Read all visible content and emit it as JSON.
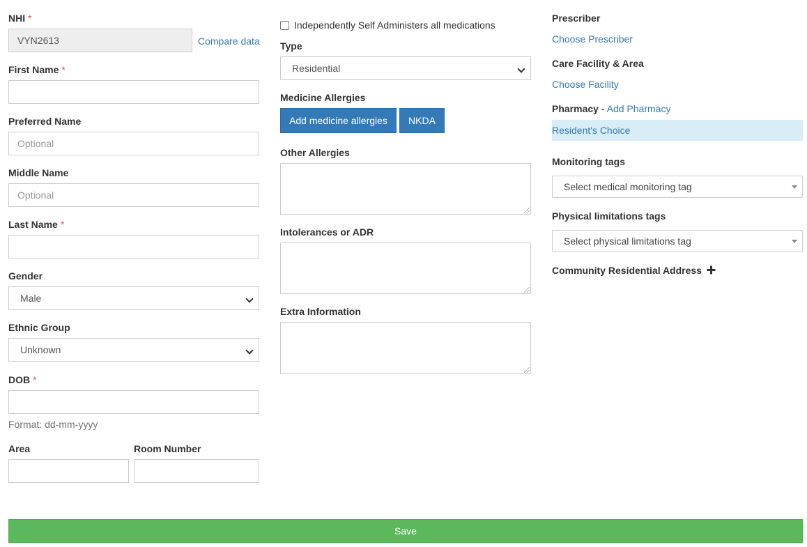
{
  "left": {
    "nhi": {
      "label": "NHI",
      "required": "*",
      "value": "VYN2613",
      "compare_link": "Compare data"
    },
    "first_name": {
      "label": "First Name",
      "required": "*",
      "value": ""
    },
    "preferred_name": {
      "label": "Preferred Name",
      "placeholder": "Optional"
    },
    "middle_name": {
      "label": "Middle Name",
      "placeholder": "Optional"
    },
    "last_name": {
      "label": "Last Name",
      "required": "*",
      "value": ""
    },
    "gender": {
      "label": "Gender",
      "selected": "Male"
    },
    "ethnic_group": {
      "label": "Ethnic Group",
      "selected": "Unknown"
    },
    "dob": {
      "label": "DOB",
      "required": "*",
      "value": "",
      "help": "Format: dd-mm-yyyy"
    },
    "area": {
      "label": "Area",
      "value": ""
    },
    "room_number": {
      "label": "Room Number",
      "value": ""
    }
  },
  "middle": {
    "self_administers": {
      "label": "Independently Self Administers all medications",
      "checked": false
    },
    "type": {
      "label": "Type",
      "selected": "Residential"
    },
    "medicine_allergies": {
      "label": "Medicine Allergies",
      "add_button": "Add medicine allergies",
      "nkda_button": "NKDA"
    },
    "other_allergies": {
      "label": "Other Allergies"
    },
    "intolerances": {
      "label": "Intolerances or ADR"
    },
    "extra_information": {
      "label": "Extra Information"
    }
  },
  "right": {
    "prescriber": {
      "label": "Prescriber",
      "link": "Choose Prescriber"
    },
    "care_facility": {
      "label": "Care Facility & Area",
      "link": "Choose Facility"
    },
    "pharmacy": {
      "label": "Pharmacy",
      "separator": "-",
      "add_link": "Add Pharmacy",
      "selected": "Resident's Choice"
    },
    "monitoring_tags": {
      "label": "Monitoring tags",
      "placeholder": "Select medical monitoring tag"
    },
    "physical_limitations": {
      "label": "Physical limitations tags",
      "placeholder": "Select physical limitations tag"
    },
    "community_address": {
      "label": "Community Residential Address",
      "icon": "plus-icon"
    }
  },
  "footer": {
    "save_label": "Save"
  },
  "colors": {
    "link": "#337ab7",
    "primary": "#337ab7",
    "success": "#5cb85c",
    "required": "#d9534f",
    "highlight": "#d9edf7"
  }
}
